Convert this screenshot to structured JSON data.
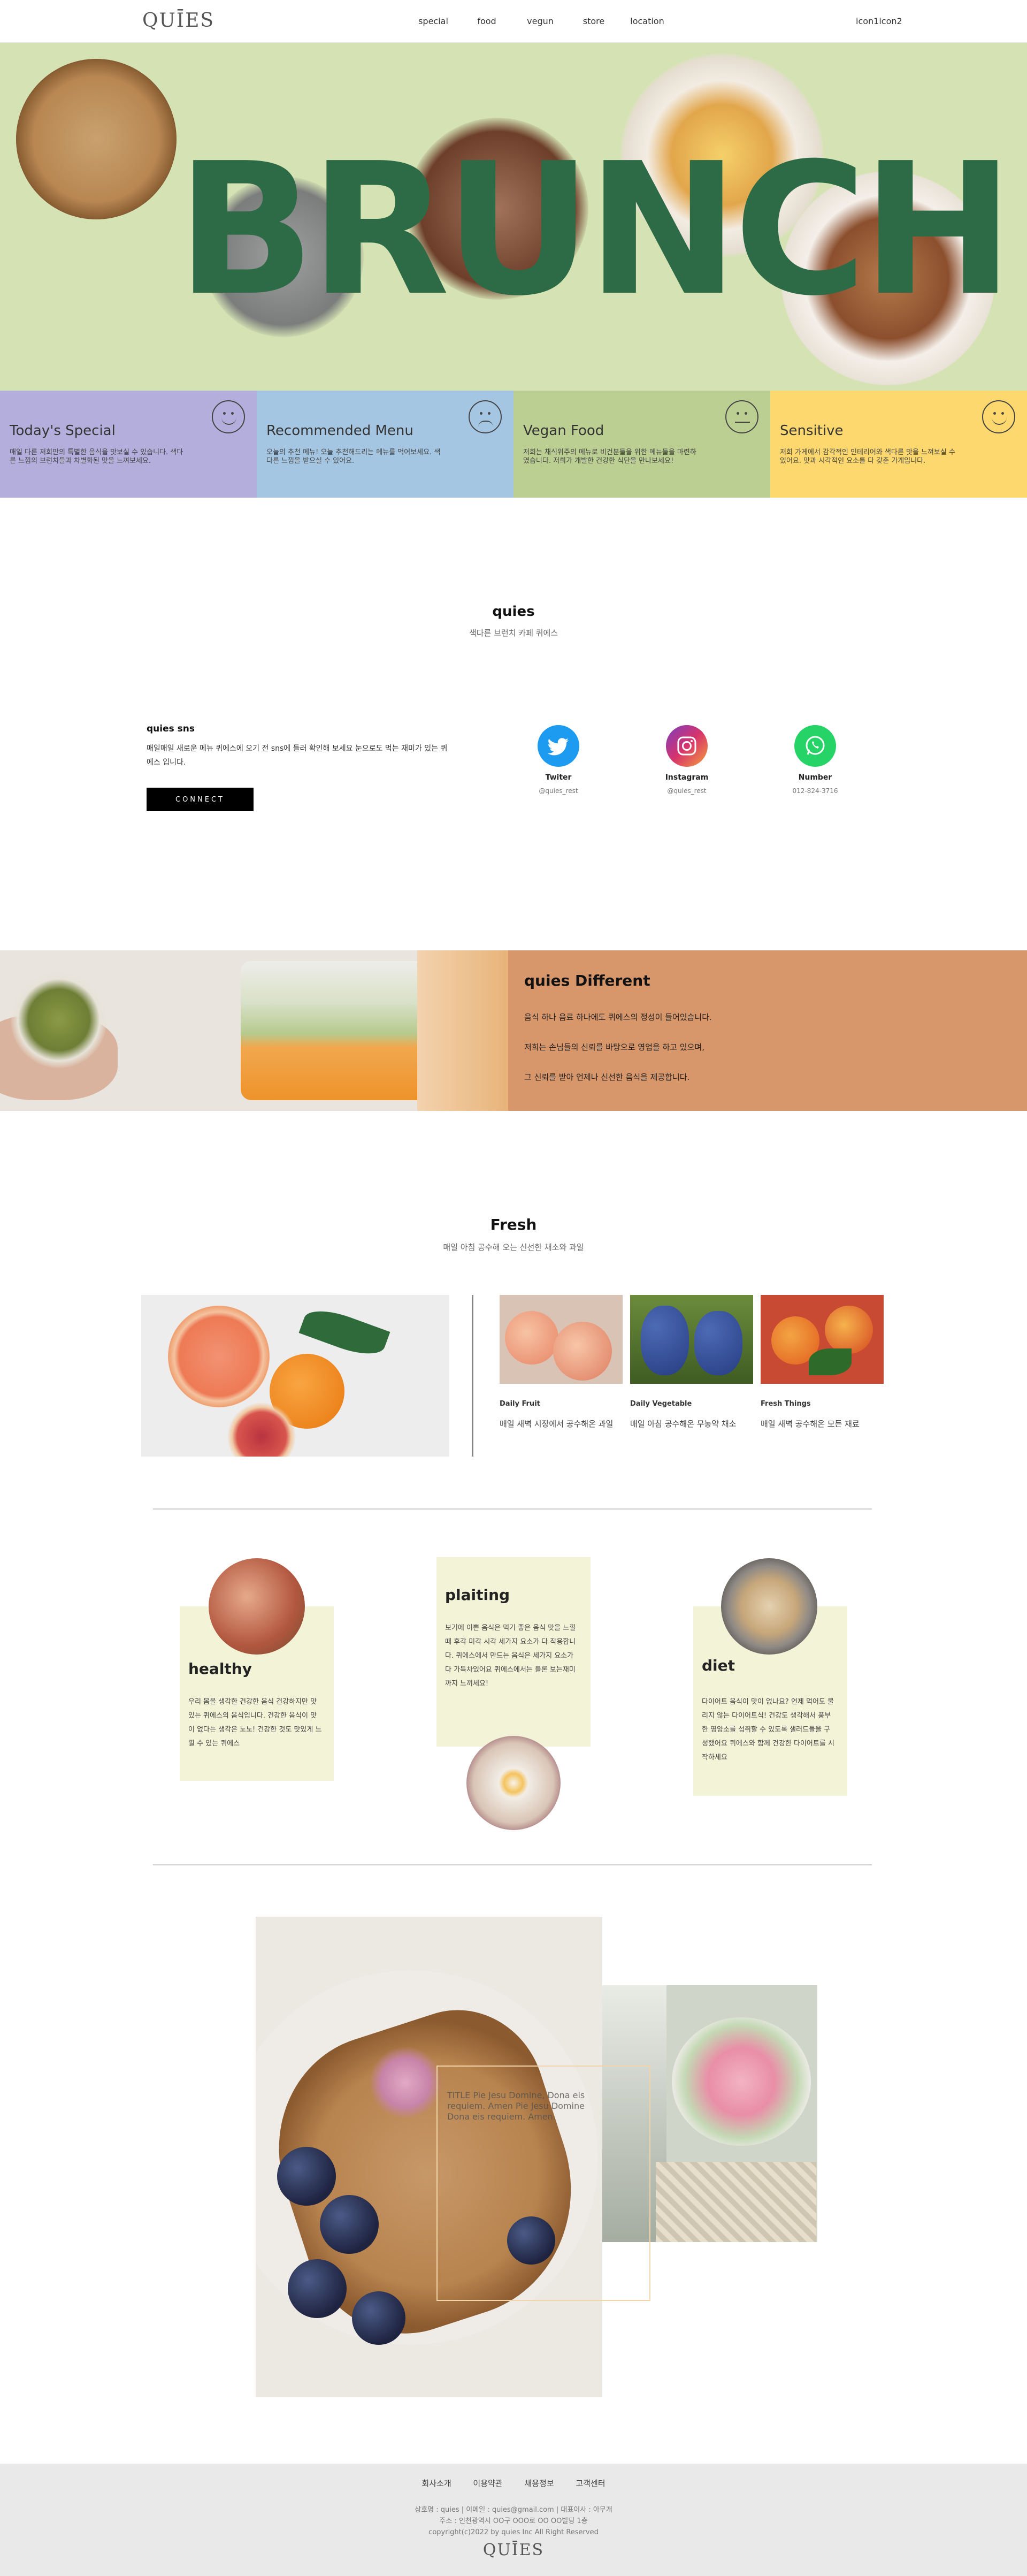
{
  "header": {
    "logo": "QUĪES",
    "nav": [
      "special",
      "food",
      "vegun",
      "store",
      "location"
    ],
    "icons_label": "icon1icon2"
  },
  "hero": {
    "word": "BRUNCH"
  },
  "categories": [
    {
      "title": "Today's Special",
      "text": "매일 다른 저희만의 특별한 음식을 맛보실 수 있습니다. 색다른 느낌의 브런치들과 차별화된 맛을 느껴보세요.",
      "color": "#b3aedb",
      "face": "smile"
    },
    {
      "title": "Recommended Menu",
      "text": "오늘의 추천 메뉴! 오늘 추천해드리는 메뉴를 먹어보세요. 색다른 느낌을 받으실 수 있어요.",
      "color": "#a5c6e2",
      "face": "sad"
    },
    {
      "title": "Vegan Food",
      "text": "저희는 채식위주의 메뉴로 비건분들을 위한 메뉴들을 마련하였습니다. 저희가 개발한 건강한 식단을 만나보세요!",
      "color": "#bccf93",
      "face": "flat"
    },
    {
      "title": "Sensitive",
      "text": "저희 가게에서 감각적인 인테리어와 색다른 맛을 느껴보실 수 있어요. 맛과 시각적인 요소를 다 갖춘 가게입니다.",
      "color": "#fdd86e",
      "face": "smile"
    }
  ],
  "intro": {
    "title": "quies",
    "subtitle": "색다른 브런치 카페 퀴에스"
  },
  "sns": {
    "title": "quies sns",
    "text": "매일매일 새로운 메뉴 퀴에스에 오기 전 sns에 들러 확인해 보세요 눈으로도 먹는 재미가 있는 퀴에스 입니다.",
    "button": "CONNECT",
    "links": [
      {
        "name": "Twiter",
        "handle": "@quies_rest",
        "color": "#1d9bf0",
        "icon": "twitter-icon"
      },
      {
        "name": "Instagram",
        "handle": "@quies_rest",
        "color": "#d6336c",
        "icon": "instagram-icon"
      },
      {
        "name": "Number",
        "handle": "012-824-3716",
        "color": "#25d366",
        "icon": "whatsapp-icon"
      }
    ]
  },
  "different": {
    "title": "quies Different",
    "lines": [
      "음식 하나 음료 하나에도 퀴에스의 정성이 들어있습니다.",
      "저희는 손님들의 신뢰를 바탕으로 영업을 하고 있으며,",
      "그 신뢰를 받아 언제나 신선한 음식을 제공합니다."
    ]
  },
  "fresh": {
    "title": "Fresh",
    "subtitle": "매일 아침 공수해 오는 신선한 채소와 과일",
    "items": [
      {
        "title": "Daily Fruit",
        "text": "매일 새벽 시장에서 공수해온 과일"
      },
      {
        "title": "Daily Vegetable",
        "text": "매일 아침 공수해온 무농약 채소"
      },
      {
        "title": "Fresh Things",
        "text": "매일 새벽 공수해온 모든 재료"
      }
    ]
  },
  "features": [
    {
      "title": "healthy",
      "text": "우리 몸을 생각한 건강한 음식 건강하지만 맛있는 퀴에스의 음식입니다. 건강한 음식이 맛이 없다는 생각은 노노! 건강한 것도 맛있게 느낄 수 있는 퀴에스"
    },
    {
      "title": "plaiting",
      "text": "보기에 이쁜 음식은 먹기 좋은 음식 맛을 느낄때 후각 미각 시각 세가지 요소가 다 작용합니다. 퀴에스에서 만드는 음식은 세가지 요소가 다 가득차있어요 퀴에스에서는 플론 보는재미까지 느끼세요!"
    },
    {
      "title": "diet",
      "text": "다이어트 음식이 맛이 없나요? 언제 먹어도 물리지 않는 다이어트식! 건강도 생각해서 풍부한 영양소를 섭취할 수 있도록 샐러드들을 구성했어요 퀴에스와 함께 건강한 다이어트를 시작하세요"
    }
  ],
  "gallery": {
    "caption": "TITLE Pie Jesu Domine, Dona eis requiem. Amen Pie Jesu Domine Dona eis requiem. Amen."
  },
  "footer": {
    "links": [
      "회사소개",
      "이용약관",
      "채용정보",
      "고객센터"
    ],
    "info_lines": [
      "상호명 : quies | 이메일 : quies@gmail.com | 대표이사 : 아무개",
      "주소 : 인천광역시 OO구 OOO로 OO OO빌딩 1층",
      "copyright(c)2022 by quies Inc All Right Reserved"
    ],
    "logo": "QUĪES"
  }
}
